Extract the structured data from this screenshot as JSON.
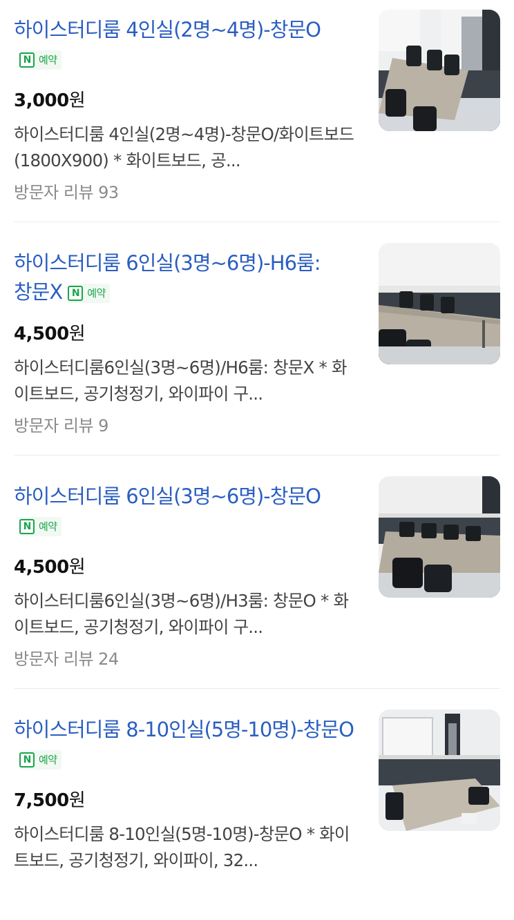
{
  "listings": [
    {
      "title": "하이스터디룸 4인실(2명~4명)-창문O",
      "badge": {
        "icon": "N",
        "label": "예약",
        "color": "#1aa44b"
      },
      "price_value": "3,000",
      "price_unit": "원",
      "description": "하이스터디룸 4인실(2명~4명)-창문O/화이트보드(1800X900) * 화이트보드, 공...",
      "reviews": "방문자 리뷰 93",
      "image_icon": "meeting-room-photo"
    },
    {
      "title": "하이스터디룸 6인실(3명~6명)-H6룸: 창문X",
      "badge": {
        "icon": "N",
        "label": "예약",
        "color": "#1aa44b"
      },
      "price_value": "4,500",
      "price_unit": "원",
      "description": "하이스터디룸6인실(3명~6명)/H6룸: 창문X * 화이트보드, 공기청정기, 와이파이 구...",
      "reviews": "방문자 리뷰 9",
      "image_icon": "meeting-room-photo"
    },
    {
      "title": "하이스터디룸 6인실(3명~6명)-창문O",
      "badge": {
        "icon": "N",
        "label": "예약",
        "color": "#1aa44b"
      },
      "price_value": "4,500",
      "price_unit": "원",
      "description": "하이스터디룸6인실(3명~6명)/H3룸: 창문O * 화이트보드, 공기청정기, 와이파이 구...",
      "reviews": "방문자 리뷰 24",
      "image_icon": "meeting-room-photo"
    },
    {
      "title": "하이스터디룸 8-10인실(5명-10명)-창문O",
      "badge": {
        "icon": "N",
        "label": "예약",
        "color": "#1aa44b"
      },
      "price_value": "7,500",
      "price_unit": "원",
      "description": "하이스터디룸 8-10인실(5명-10명)-창문O * 화이트보드, 공기청정기, 와이파이, 32...",
      "reviews": "",
      "image_icon": "meeting-room-photo"
    }
  ],
  "colors": {
    "title": "#2a5ec0",
    "price": "#111111",
    "description": "#444444",
    "review": "#8a8a8a",
    "naver_green": "#1aa44b",
    "separator": "#ececec"
  }
}
